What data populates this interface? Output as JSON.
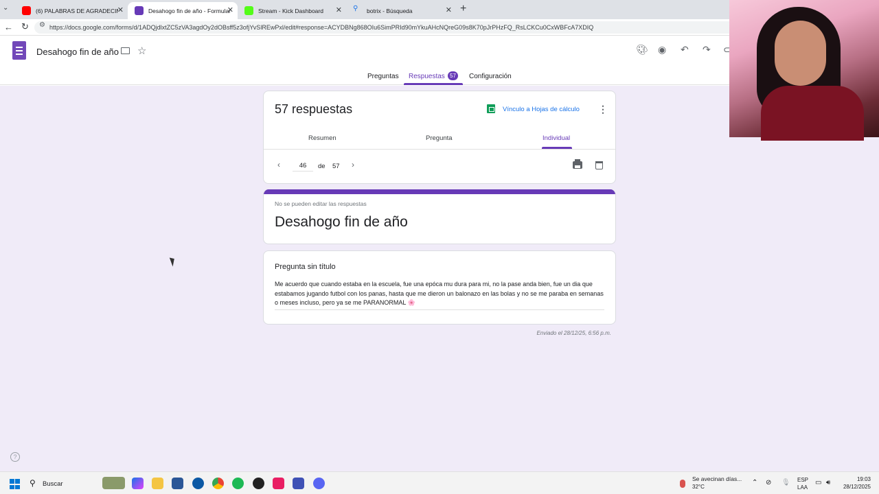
{
  "browser": {
    "tabs": [
      {
        "label": "(6) PALABRAS DE AGRADECIMIEN",
        "favicon_color": "#ff0000"
      },
      {
        "label": "Desahogo fin de año - Formulario",
        "favicon_color": "#673ab7"
      },
      {
        "label": "Stream - Kick Dashboard",
        "favicon_color": "#53fc18"
      },
      {
        "label": "botrix - Búsqueda",
        "favicon_color": "#1a73e8"
      }
    ],
    "url": "https://docs.google.com/forms/d/1ADQjdlxtZC5zVA3agdOy2dOBsff5z3ofjYvSlREwPxl/edit#response=ACYDBNg868OIu6SimPRId90mYkuAHcNQreG09s8K70pJrPHzFQ_RsLCKCu0CxWBFcA7XDIQ"
  },
  "form_header": {
    "doc_title": "Desahogo fin de año",
    "tabs": {
      "questions": "Preguntas",
      "responses": "Respuestas",
      "settings": "Configuración"
    },
    "response_badge": "57"
  },
  "summary_card": {
    "count_text": "57 respuestas",
    "sheets_link": "Vínculo a Hojas de cálculo",
    "subtabs": {
      "summary": "Resumen",
      "question": "Pregunta",
      "individual": "Individual"
    },
    "pager": {
      "current": "46",
      "of": "de",
      "total": "57"
    }
  },
  "form_card": {
    "notice": "No se pueden editar las respuestas",
    "title": "Desahogo fin de año"
  },
  "question_card": {
    "title": "Pregunta sin título",
    "answer": "Me acuerdo que cuando estaba en la escuela, fue una epóca mu dura para mi, no la pase anda bien, fue un dia que estabamos jugando futbol con los panas, hasta que me dieron un balonazo en las bolas y no se me paraba en semanas o meses incluso, pero ya se me PARANORMAL 🌸"
  },
  "submitted_text": "Enviado el 28/12/25, 6:56 p.m.",
  "taskbar": {
    "search_label": "Buscar",
    "weather_text": "Se avecinan días...",
    "weather_temp": "32°C",
    "lang_1": "ESP",
    "lang_2": "LAA",
    "time": "19:03",
    "date": "28/12/2025"
  },
  "colors": {
    "accent": "#673ab7",
    "link": "#1a73e8",
    "background": "#f0ebf8"
  }
}
